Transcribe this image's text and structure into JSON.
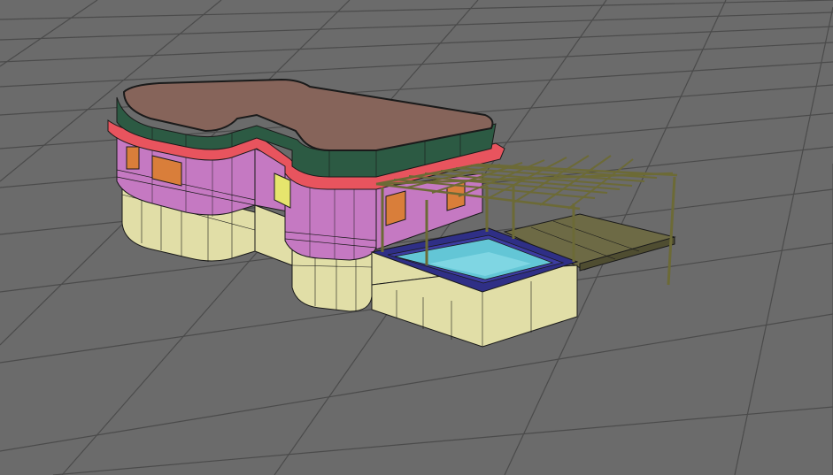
{
  "viewport": {
    "background_color": "#6b6b6b",
    "grid_color": "#4a4a4a",
    "grid_visible": true,
    "wireframe_color": "#1a1a1a"
  },
  "model": {
    "roof_color": "#86645a",
    "fascia_color": "#2c5a43",
    "trim_color": "#e8545e",
    "wall_color": "#c579c2",
    "base_color": "#e1dea7",
    "window_color": "#d97e3a",
    "door_color": "#e6e56d",
    "pool_water_color": "#63c6d6",
    "pool_rim_color": "#2f2f86",
    "deck_color": "#6d6a45",
    "pergola_color": "#6c6a36"
  }
}
